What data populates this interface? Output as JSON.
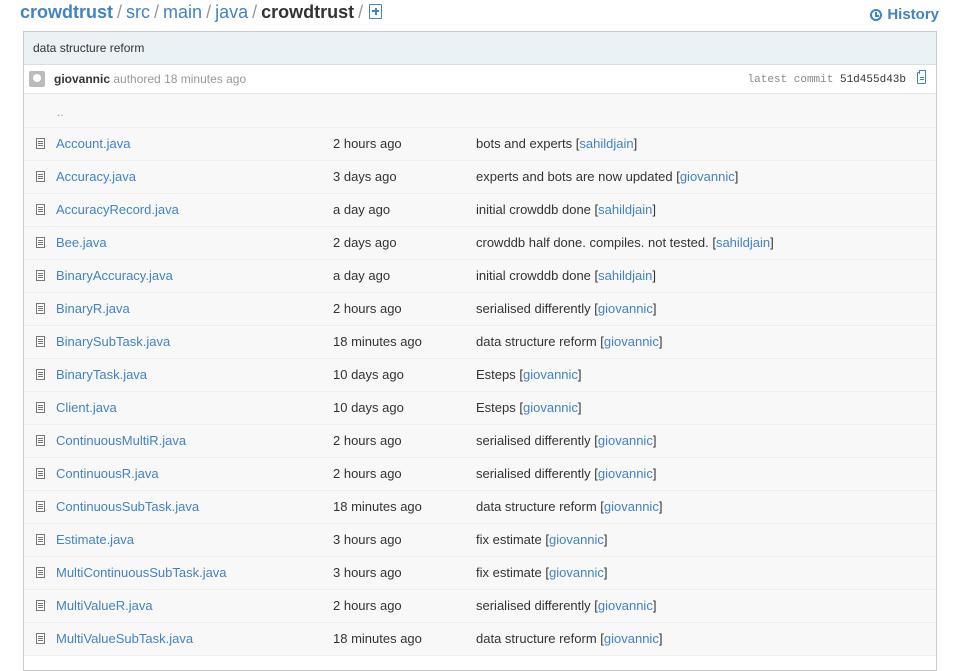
{
  "breadcrumb": [
    "crowdtrust",
    "src",
    "main",
    "java",
    "crowdtrust"
  ],
  "breadcrumb_separator": "/",
  "history_label": "History",
  "commit": {
    "message": "data structure reform",
    "author": "giovannic",
    "authored_text": "authored 18 minutes ago",
    "latest_label": "latest commit",
    "sha": "51d455d43b"
  },
  "up_link": "..",
  "files": [
    {
      "name": "Account.java",
      "age": "2 hours ago",
      "message": "bots and experts",
      "author": "sahildjain"
    },
    {
      "name": "Accuracy.java",
      "age": "3 days ago",
      "message": "experts and bots are now updated",
      "author": "giovannic"
    },
    {
      "name": "AccuracyRecord.java",
      "age": "a day ago",
      "message": "initial crowddb done",
      "author": "sahildjain"
    },
    {
      "name": "Bee.java",
      "age": "2 days ago",
      "message": "crowddb half done. compiles. not tested.",
      "author": "sahildjain"
    },
    {
      "name": "BinaryAccuracy.java",
      "age": "a day ago",
      "message": "initial crowddb done",
      "author": "sahildjain"
    },
    {
      "name": "BinaryR.java",
      "age": "2 hours ago",
      "message": "serialised differently",
      "author": "giovannic"
    },
    {
      "name": "BinarySubTask.java",
      "age": "18 minutes ago",
      "message": "data structure reform",
      "author": "giovannic"
    },
    {
      "name": "BinaryTask.java",
      "age": "10 days ago",
      "message": "Esteps",
      "author": "giovannic"
    },
    {
      "name": "Client.java",
      "age": "10 days ago",
      "message": "Esteps",
      "author": "giovannic"
    },
    {
      "name": "ContinuousMultiR.java",
      "age": "2 hours ago",
      "message": "serialised differently",
      "author": "giovannic"
    },
    {
      "name": "ContinuousR.java",
      "age": "2 hours ago",
      "message": "serialised differently",
      "author": "giovannic"
    },
    {
      "name": "ContinuousSubTask.java",
      "age": "18 minutes ago",
      "message": "data structure reform",
      "author": "giovannic"
    },
    {
      "name": "Estimate.java",
      "age": "3 hours ago",
      "message": "fix estimate",
      "author": "giovannic"
    },
    {
      "name": "MultiContinuousSubTask.java",
      "age": "3 hours ago",
      "message": "fix estimate",
      "author": "giovannic"
    },
    {
      "name": "MultiValueR.java",
      "age": "2 hours ago",
      "message": "serialised differently",
      "author": "giovannic"
    },
    {
      "name": "MultiValueSubTask.java",
      "age": "18 minutes ago",
      "message": "data structure reform",
      "author": "giovannic"
    }
  ],
  "icons": {
    "file": "file-icon",
    "history": "history-icon",
    "new_file": "new-file-icon",
    "clipboard": "clipboard-icon",
    "avatar": "avatar"
  },
  "colors": {
    "link": "#4183c4",
    "commit_bar": "#eaf2f5",
    "row_bg": "#f8f8f8"
  }
}
